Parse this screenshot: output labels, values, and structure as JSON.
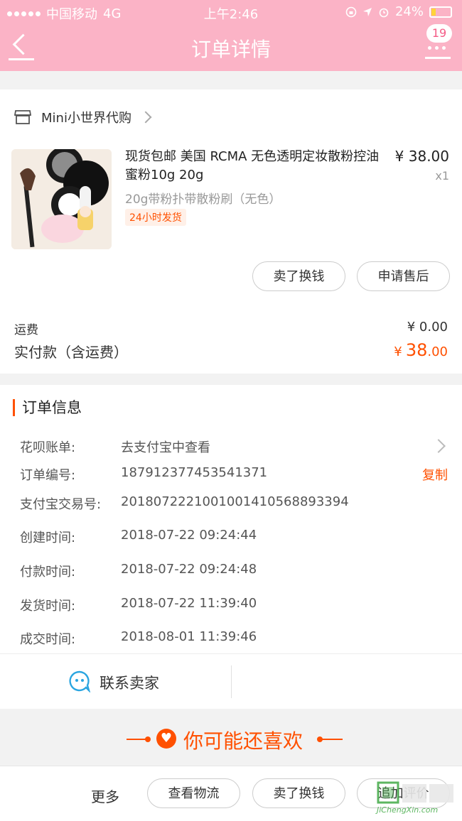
{
  "status_bar": {
    "carrier": "中国移动",
    "network": "4G",
    "time": "上午2:46",
    "battery": "24%"
  },
  "nav": {
    "title": "订单详情",
    "badge": "19"
  },
  "shop": {
    "name": "Mini小世界代购"
  },
  "product": {
    "title": "现货包邮 美国 RCMA 无色透明定妆散粉控油 蜜粉10g 20g",
    "price": "¥ 38.00",
    "quantity": "x1",
    "sku": "20g带粉扑带散粉刷（无色）",
    "tag": "24小时发货"
  },
  "actions": {
    "sell": "卖了换钱",
    "after_sale": "申请售后"
  },
  "fees": {
    "shipping_label": "运费",
    "shipping_value": "¥ 0.00",
    "paid_label": "实付款（含运费）",
    "paid_currency": "¥",
    "paid_int": "38",
    "paid_dec": ".00"
  },
  "order_info": {
    "title": "订单信息",
    "rows": [
      {
        "key": "花呗账单:",
        "value": "去支付宝中查看"
      },
      {
        "key": "订单编号:",
        "value": "187912377453541371"
      },
      {
        "key": "支付宝交易号:",
        "value": "2018072221001001410568893394"
      },
      {
        "key": "创建时间:",
        "value": "2018-07-22 09:24:44"
      },
      {
        "key": "付款时间:",
        "value": "2018-07-22 09:24:48"
      },
      {
        "key": "发货时间:",
        "value": "2018-07-22 11:39:40"
      },
      {
        "key": "成交时间:",
        "value": "2018-08-01 11:39:46"
      }
    ],
    "copy_label": "复制"
  },
  "contact": {
    "label": "联系卖家"
  },
  "recommend": {
    "label": "你可能还喜欢"
  },
  "bottom_bar": {
    "more": "更多",
    "logistics": "查看物流",
    "sell": "卖了换钱",
    "review": "追加评价"
  },
  "watermark": {
    "text": "JiChengXin.com"
  },
  "colors": {
    "header": "#fbb3c6",
    "accent": "#ff5000"
  }
}
